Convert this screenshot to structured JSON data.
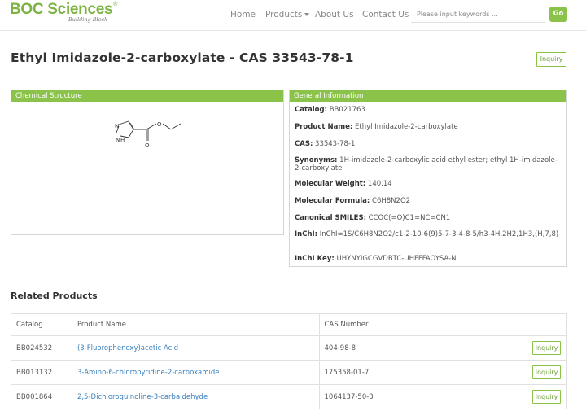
{
  "header": {
    "logo_text": "BOC Sciences",
    "logo_sub": "Building Block",
    "nav": [
      {
        "label": "Home"
      },
      {
        "label": "Products"
      },
      {
        "label": "About Us"
      },
      {
        "label": "Contact Us"
      }
    ],
    "search_placeholder": "Please input keywords ...",
    "go_label": "Go"
  },
  "product": {
    "title": "Ethyl Imidazole-2-carboxylate - CAS 33543-78-1",
    "inquiry_label": "Inquiry"
  },
  "structure_panel": {
    "title": "Chemical Structure",
    "nh_label": "N",
    "h_label": "H",
    "n_label": "N",
    "o1_label": "O",
    "o2_label": "O"
  },
  "info_panel": {
    "title": "General Information",
    "rows": [
      {
        "label": "Catalog:",
        "value": "BB021763"
      },
      {
        "label": "Product Name:",
        "value": "Ethyl Imidazole-2-carboxylate"
      },
      {
        "label": "CAS:",
        "value": "33543-78-1"
      },
      {
        "label": "Synonyms:",
        "value": "1H-imidazole-2-carboxylic acid ethyl ester; ethyl 1H-imidazole-2-carboxylate"
      },
      {
        "label": "Molecular Weight:",
        "value": "140.14"
      },
      {
        "label": "Molecular Formula:",
        "value": "C6H8N2O2"
      },
      {
        "label": "Canonical SMILES:",
        "value": "CCOC(=O)C1=NC=CN1"
      },
      {
        "label": "InChI:",
        "value": "InChI=1S/C6H8N2O2/c1-2-10-6(9)5-7-3-4-8-5/h3-4H,2H2,1H3,(H,7,8)"
      },
      {
        "label": "InChI Key:",
        "value": "UHYNYIGCGVDBTC-UHFFFAOYSA-N"
      }
    ]
  },
  "related": {
    "title": "Related Products",
    "columns": [
      "Catalog",
      "Product Name",
      "CAS Number"
    ],
    "inquiry_label": "Inquiry",
    "rows": [
      {
        "catalog": "BB024532",
        "name": "(3-Fluorophenoxy)acetic Acid",
        "cas": "404-98-8"
      },
      {
        "catalog": "BB013132",
        "name": "3-Amino-6-chloropyridine-2-carboxamide",
        "cas": "175358-01-7"
      },
      {
        "catalog": "BB001864",
        "name": "2,5-Dichloroquinoline-3-carbaldehyde",
        "cas": "1064137-50-3"
      }
    ]
  },
  "colors": {
    "brand_green": "#8bc34a",
    "link_blue": "#3a7fbe"
  }
}
